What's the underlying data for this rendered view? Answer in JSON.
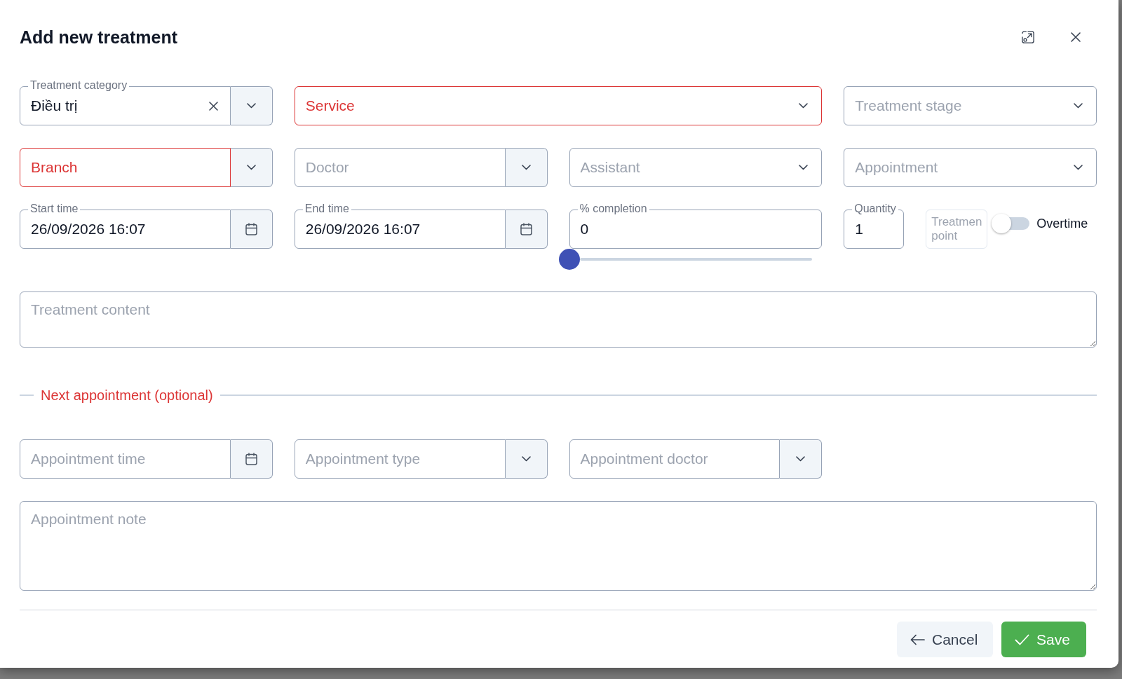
{
  "dialog": {
    "title": "Add new treatment"
  },
  "form_rows": [
    [
      {
        "kind": "combo",
        "label": "Treatment category",
        "value": "Điều trị",
        "clearable": true,
        "invalid": false
      },
      {
        "kind": "select",
        "placeholder": "Service",
        "invalid": true
      },
      {
        "kind": "select",
        "placeholder": "Treatment stage",
        "invalid": false
      }
    ],
    [
      {
        "kind": "combo",
        "placeholder": "Branch",
        "invalid": true
      },
      {
        "kind": "combo",
        "placeholder": "Doctor",
        "invalid": false
      },
      {
        "kind": "select",
        "placeholder": "Assistant",
        "invalid": false
      },
      {
        "kind": "select",
        "placeholder": "Appointment",
        "invalid": false
      }
    ],
    [
      {
        "kind": "date",
        "label": "Start time",
        "value": "26/09/2026 16:07",
        "invalid": false
      },
      {
        "kind": "date",
        "label": "End time",
        "value": "26/09/2026 16:07",
        "invalid": false
      },
      {
        "kind": "percent",
        "label": "% completion",
        "value": "0",
        "level": 0,
        "invalid": false
      },
      {
        "kind": "group",
        "items": [
          {
            "kind": "number",
            "label": "Quantity",
            "value": "1",
            "disabled": false
          },
          {
            "kind": "text",
            "placeholder": "Treatmen point",
            "disabled": true
          },
          {
            "kind": "switch",
            "label": "Overtime",
            "on": false
          }
        ]
      }
    ]
  ],
  "treatment_content": {
    "placeholder": "Treatment content"
  },
  "next_appointment": {
    "heading": "Next appointment (optional)",
    "fields": [
      {
        "kind": "date",
        "placeholder": "Appointment time"
      },
      {
        "kind": "combo",
        "placeholder": "Appointment type"
      },
      {
        "kind": "combo",
        "placeholder": "Appointment doctor"
      }
    ],
    "note": {
      "placeholder": "Appointment note"
    }
  },
  "buttons": [
    {
      "kind": "cancel",
      "label": "Cancel"
    },
    {
      "kind": "save",
      "label": "Save"
    }
  ]
}
